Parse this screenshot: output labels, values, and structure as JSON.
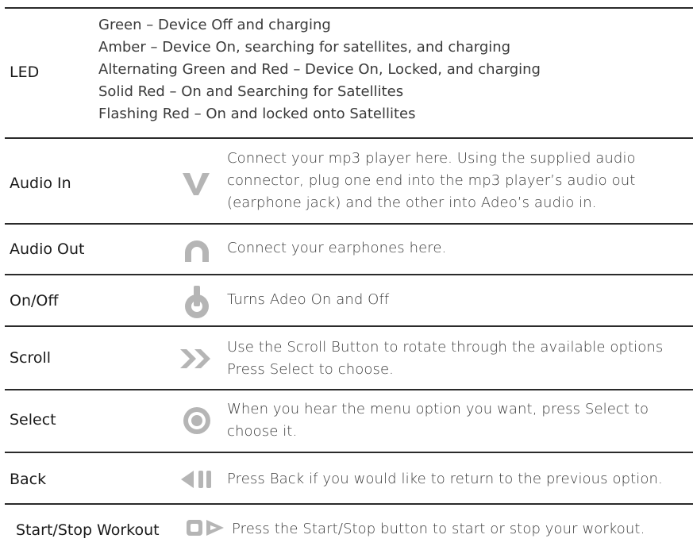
{
  "rows": {
    "led": {
      "label": "LED",
      "lines": [
        "Green – Device Off and charging",
        "Amber – Device On, searching for satellites, and charging",
        "Alternating Green and Red – Device On, Locked, and charging",
        "Solid Red – On and Searching for Satellites",
        "Flashing Red – On and locked onto Satellites"
      ]
    },
    "audio_in": {
      "label": "Audio In",
      "icon": "v-chevron-icon",
      "lines": [
        "Connect your mp3 player here. Using the supplied audio",
        "connector, plug one end into the mp3 player’s audio out",
        "(earphone jack) and the other into Adeo’s audio in."
      ]
    },
    "audio_out": {
      "label": "Audio Out",
      "icon": "headphone-icon",
      "lines": [
        "Connect your earphones here."
      ]
    },
    "on_off": {
      "label": "On/Off",
      "icon": "power-icon",
      "lines": [
        "Turns Adeo On and Off"
      ]
    },
    "scroll": {
      "label": "Scroll",
      "icon": "double-chevron-right-icon",
      "lines": [
        "Use the Scroll Button to rotate through the available options",
        "Press Select to choose."
      ]
    },
    "select": {
      "label": "Select",
      "icon": "select-target-icon",
      "lines": [
        "When you hear the menu option you want, press Select to",
        "choose it."
      ]
    },
    "back": {
      "label": "Back",
      "icon": "back-icon",
      "lines": [
        "Press Back if you would like to return to the previous option."
      ]
    },
    "start_stop": {
      "label": "Start/Stop Workout",
      "icon": "start-stop-icon",
      "lines": [
        "Press the Start/Stop button to start or stop your workout."
      ]
    }
  },
  "colors": {
    "icon": "#b5b5b5",
    "rule": "#2a2a2a"
  }
}
